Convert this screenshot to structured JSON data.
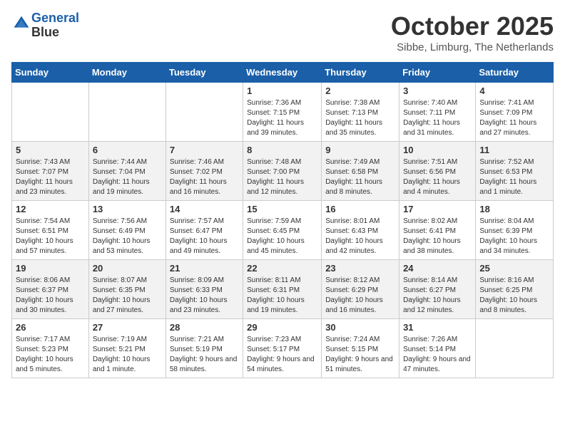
{
  "header": {
    "logo_line1": "General",
    "logo_line2": "Blue",
    "month": "October 2025",
    "location": "Sibbe, Limburg, The Netherlands"
  },
  "weekdays": [
    "Sunday",
    "Monday",
    "Tuesday",
    "Wednesday",
    "Thursday",
    "Friday",
    "Saturday"
  ],
  "weeks": [
    [
      {
        "day": "",
        "info": ""
      },
      {
        "day": "",
        "info": ""
      },
      {
        "day": "",
        "info": ""
      },
      {
        "day": "1",
        "info": "Sunrise: 7:36 AM\nSunset: 7:15 PM\nDaylight: 11 hours and 39 minutes."
      },
      {
        "day": "2",
        "info": "Sunrise: 7:38 AM\nSunset: 7:13 PM\nDaylight: 11 hours and 35 minutes."
      },
      {
        "day": "3",
        "info": "Sunrise: 7:40 AM\nSunset: 7:11 PM\nDaylight: 11 hours and 31 minutes."
      },
      {
        "day": "4",
        "info": "Sunrise: 7:41 AM\nSunset: 7:09 PM\nDaylight: 11 hours and 27 minutes."
      }
    ],
    [
      {
        "day": "5",
        "info": "Sunrise: 7:43 AM\nSunset: 7:07 PM\nDaylight: 11 hours and 23 minutes."
      },
      {
        "day": "6",
        "info": "Sunrise: 7:44 AM\nSunset: 7:04 PM\nDaylight: 11 hours and 19 minutes."
      },
      {
        "day": "7",
        "info": "Sunrise: 7:46 AM\nSunset: 7:02 PM\nDaylight: 11 hours and 16 minutes."
      },
      {
        "day": "8",
        "info": "Sunrise: 7:48 AM\nSunset: 7:00 PM\nDaylight: 11 hours and 12 minutes."
      },
      {
        "day": "9",
        "info": "Sunrise: 7:49 AM\nSunset: 6:58 PM\nDaylight: 11 hours and 8 minutes."
      },
      {
        "day": "10",
        "info": "Sunrise: 7:51 AM\nSunset: 6:56 PM\nDaylight: 11 hours and 4 minutes."
      },
      {
        "day": "11",
        "info": "Sunrise: 7:52 AM\nSunset: 6:53 PM\nDaylight: 11 hours and 1 minute."
      }
    ],
    [
      {
        "day": "12",
        "info": "Sunrise: 7:54 AM\nSunset: 6:51 PM\nDaylight: 10 hours and 57 minutes."
      },
      {
        "day": "13",
        "info": "Sunrise: 7:56 AM\nSunset: 6:49 PM\nDaylight: 10 hours and 53 minutes."
      },
      {
        "day": "14",
        "info": "Sunrise: 7:57 AM\nSunset: 6:47 PM\nDaylight: 10 hours and 49 minutes."
      },
      {
        "day": "15",
        "info": "Sunrise: 7:59 AM\nSunset: 6:45 PM\nDaylight: 10 hours and 45 minutes."
      },
      {
        "day": "16",
        "info": "Sunrise: 8:01 AM\nSunset: 6:43 PM\nDaylight: 10 hours and 42 minutes."
      },
      {
        "day": "17",
        "info": "Sunrise: 8:02 AM\nSunset: 6:41 PM\nDaylight: 10 hours and 38 minutes."
      },
      {
        "day": "18",
        "info": "Sunrise: 8:04 AM\nSunset: 6:39 PM\nDaylight: 10 hours and 34 minutes."
      }
    ],
    [
      {
        "day": "19",
        "info": "Sunrise: 8:06 AM\nSunset: 6:37 PM\nDaylight: 10 hours and 30 minutes."
      },
      {
        "day": "20",
        "info": "Sunrise: 8:07 AM\nSunset: 6:35 PM\nDaylight: 10 hours and 27 minutes."
      },
      {
        "day": "21",
        "info": "Sunrise: 8:09 AM\nSunset: 6:33 PM\nDaylight: 10 hours and 23 minutes."
      },
      {
        "day": "22",
        "info": "Sunrise: 8:11 AM\nSunset: 6:31 PM\nDaylight: 10 hours and 19 minutes."
      },
      {
        "day": "23",
        "info": "Sunrise: 8:12 AM\nSunset: 6:29 PM\nDaylight: 10 hours and 16 minutes."
      },
      {
        "day": "24",
        "info": "Sunrise: 8:14 AM\nSunset: 6:27 PM\nDaylight: 10 hours and 12 minutes."
      },
      {
        "day": "25",
        "info": "Sunrise: 8:16 AM\nSunset: 6:25 PM\nDaylight: 10 hours and 8 minutes."
      }
    ],
    [
      {
        "day": "26",
        "info": "Sunrise: 7:17 AM\nSunset: 5:23 PM\nDaylight: 10 hours and 5 minutes."
      },
      {
        "day": "27",
        "info": "Sunrise: 7:19 AM\nSunset: 5:21 PM\nDaylight: 10 hours and 1 minute."
      },
      {
        "day": "28",
        "info": "Sunrise: 7:21 AM\nSunset: 5:19 PM\nDaylight: 9 hours and 58 minutes."
      },
      {
        "day": "29",
        "info": "Sunrise: 7:23 AM\nSunset: 5:17 PM\nDaylight: 9 hours and 54 minutes."
      },
      {
        "day": "30",
        "info": "Sunrise: 7:24 AM\nSunset: 5:15 PM\nDaylight: 9 hours and 51 minutes."
      },
      {
        "day": "31",
        "info": "Sunrise: 7:26 AM\nSunset: 5:14 PM\nDaylight: 9 hours and 47 minutes."
      },
      {
        "day": "",
        "info": ""
      }
    ]
  ]
}
